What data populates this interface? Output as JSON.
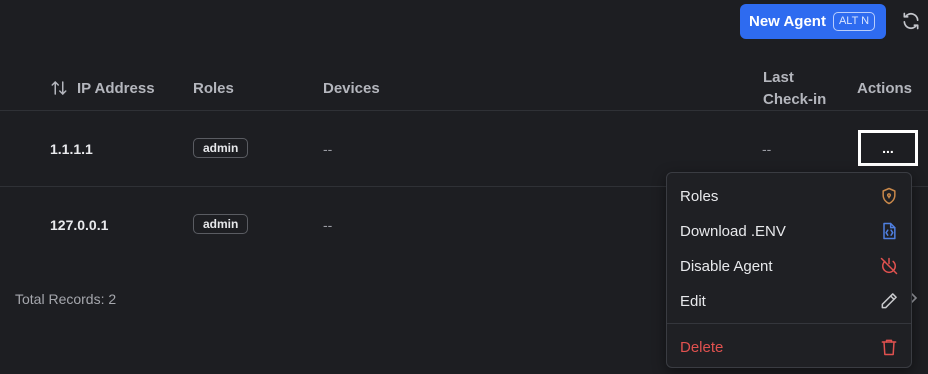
{
  "header": {
    "new_agent_label": "New Agent",
    "new_agent_shortcut": "ALT N",
    "refresh_icon": "refresh-icon",
    "accent": "#2e6bf0"
  },
  "table": {
    "columns": {
      "ip": "IP Address",
      "roles": "Roles",
      "devices": "Devices",
      "last_checkin_1": "Last",
      "last_checkin_2": "Check-in",
      "actions": "Actions"
    },
    "rows": [
      {
        "ip": "1.1.1.1",
        "role": "admin",
        "devices": "--",
        "last_checkin": "--",
        "actions": "..."
      },
      {
        "ip": "127.0.0.1",
        "role": "admin",
        "devices": "--"
      }
    ]
  },
  "footer": {
    "total_records": "Total Records: 2"
  },
  "menu": {
    "items": [
      {
        "label": "Roles",
        "icon": "shield-icon",
        "color": "#c9884a"
      },
      {
        "label": "Download .ENV",
        "icon": "file-code-icon",
        "color": "#4f7fe0"
      },
      {
        "label": "Disable Agent",
        "icon": "power-off-icon",
        "color": "#e0514f"
      },
      {
        "label": "Edit",
        "icon": "pencil-icon",
        "color": "#c8c9cc"
      },
      {
        "label": "Delete",
        "icon": "trash-icon",
        "color": "#e0514f"
      }
    ]
  }
}
